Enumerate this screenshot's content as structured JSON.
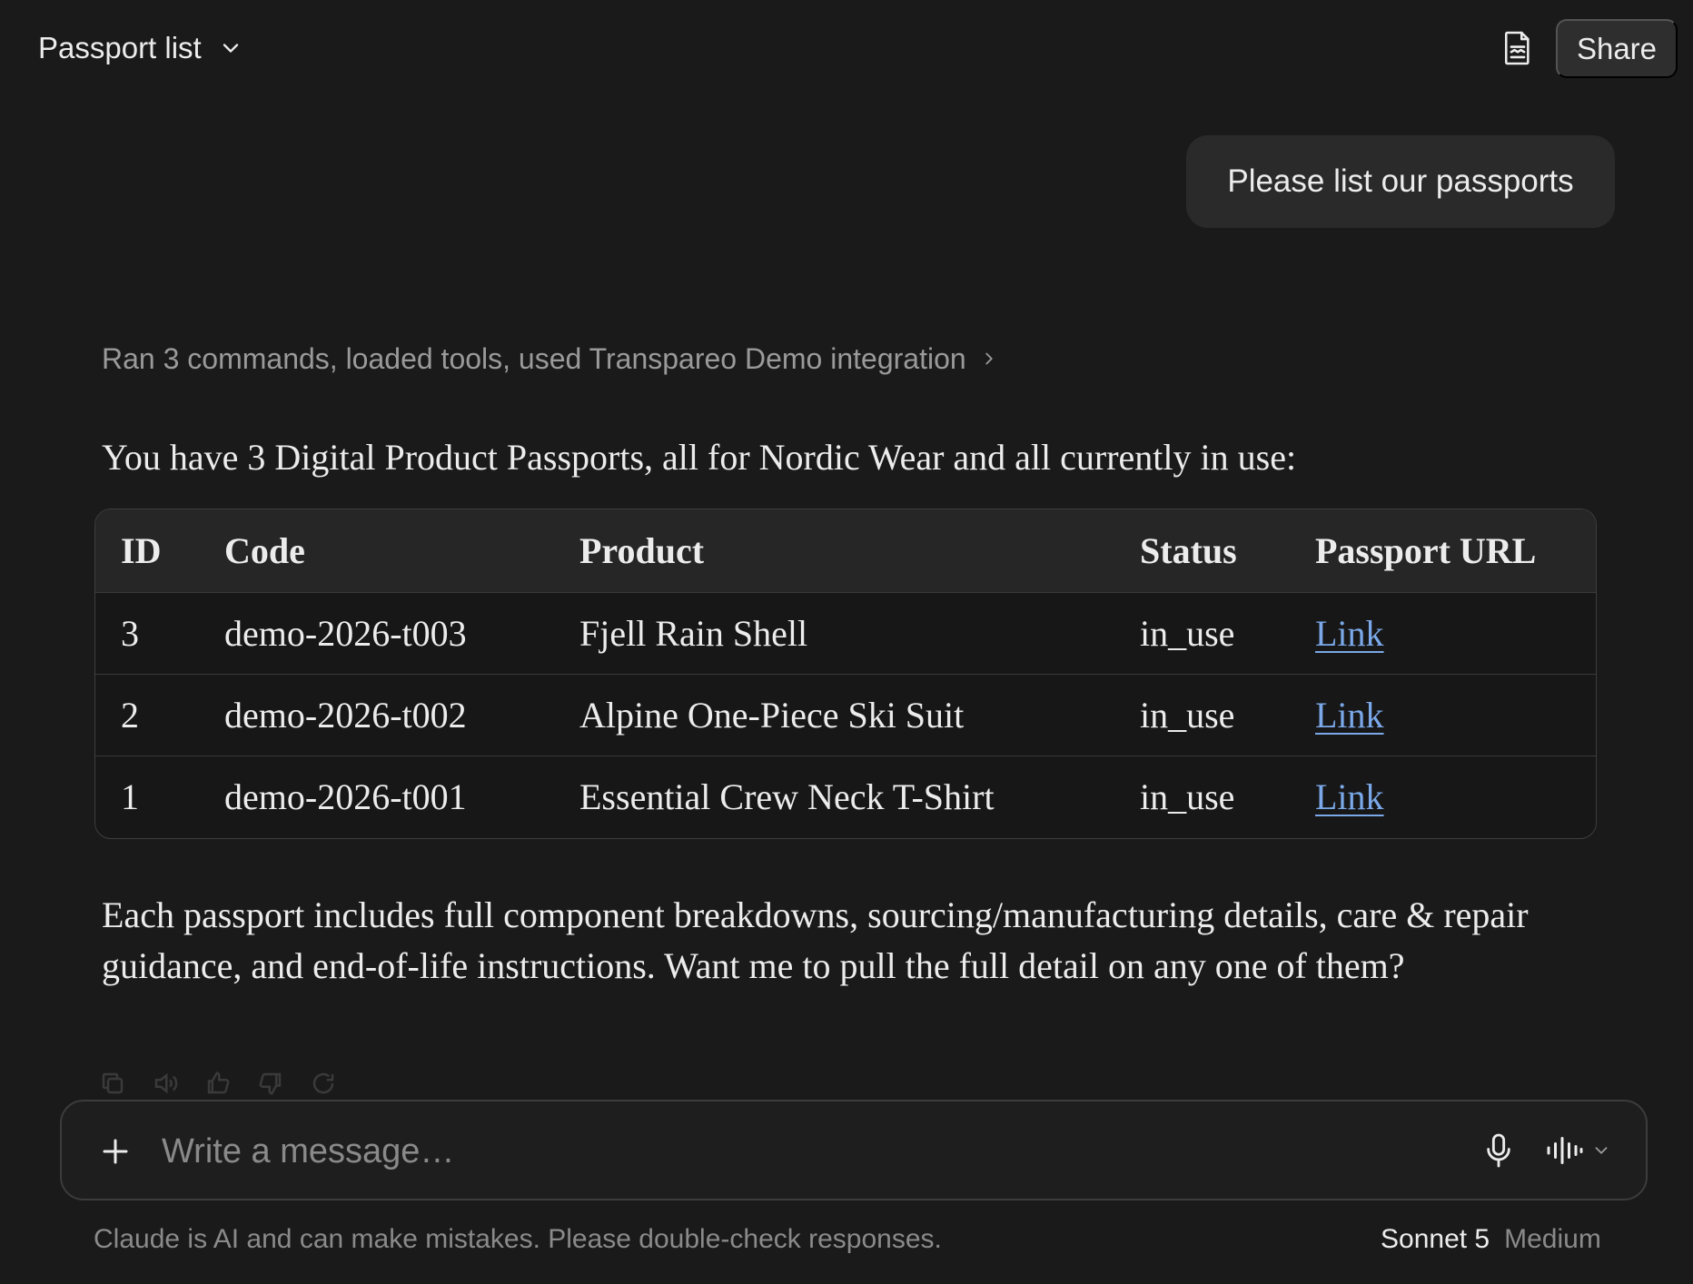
{
  "header": {
    "title": "Passport list",
    "share_label": "Share"
  },
  "user_message": "Please list our passports",
  "tool_summary": "Ran 3 commands, loaded tools, used Transpareo Demo integration",
  "assistant": {
    "intro": "You have 3 Digital Product Passports, all for Nordic Wear and all currently in use:",
    "table": {
      "headers": [
        "ID",
        "Code",
        "Product",
        "Status",
        "Passport URL"
      ],
      "rows": [
        [
          "3",
          "demo-2026-t003",
          "Fjell Rain Shell",
          "in_use",
          "Link"
        ],
        [
          "2",
          "demo-2026-t002",
          "Alpine One-Piece Ski Suit",
          "in_use",
          "Link"
        ],
        [
          "1",
          "demo-2026-t001",
          "Essential Crew Neck T-Shirt",
          "in_use",
          "Link"
        ]
      ]
    },
    "outro": "Each passport includes full component breakdowns, sourcing/manufacturing details, care & repair guidance, and end-of-life instructions. Want me to pull the full detail on any one of them?"
  },
  "action_icons": [
    "copy-icon",
    "speaker-icon",
    "thumbs-up-icon",
    "thumbs-down-icon",
    "retry-icon"
  ],
  "composer": {
    "placeholder": "Write a message…"
  },
  "footer": {
    "disclaimer": "Claude is AI and can make mistakes. Please double-check responses.",
    "model_name": "Sonnet 5",
    "model_mode": "Medium"
  },
  "colors": {
    "background": "#1a1a1a",
    "text": "#ececec",
    "muted": "#8a8a8a",
    "link": "#7aa8e8",
    "bubble": "#2a2a2a"
  }
}
